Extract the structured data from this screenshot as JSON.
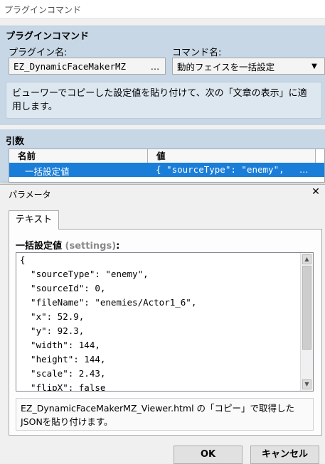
{
  "window": {
    "title": "プラグインコマンド"
  },
  "plugin_command": {
    "section_title": "プラグインコマンド",
    "plugin_label": "プラグイン名:",
    "plugin_value": "EZ_DynamicFaceMakerMZ",
    "plugin_button": "…",
    "command_label": "コマンド名:",
    "command_value": "動的フェイスを一括設定",
    "command_arrow": "▼",
    "description": "ビューワーでコピーした設定値を貼り付けて、次の「文章の表示」に適用します。"
  },
  "arguments": {
    "section_title": "引数",
    "columns": [
      "名前",
      "値"
    ],
    "rows": [
      {
        "name": "一括設定値",
        "value": "{ \"sourceType\": \"enemy\",",
        "more": "…"
      }
    ]
  },
  "dialog": {
    "title": "パラメータ",
    "close_glyph": "✕",
    "tab_label": "テキスト",
    "param_label": "一括設定値",
    "param_key": "(settings)",
    "param_colon": ":",
    "code_lines": [
      "{",
      "  \"sourceType\": \"enemy\",",
      "  \"sourceId\": 0,",
      "  \"fileName\": \"enemies/Actor1_6\",",
      "  \"x\": 52.9,",
      "  \"y\": 92.3,",
      "  \"width\": 144,",
      "  \"height\": 144,",
      "  \"scale\": 2.43,",
      "  \"flipX\": false"
    ],
    "scroll_up_glyph": "▲",
    "scroll_down_glyph": "▼",
    "help_text": "EZ_DynamicFaceMakerMZ_Viewer.html の「コピー」で取得したJSONを貼り付けます。",
    "ok_label": "OK",
    "cancel_label": "キャンセル"
  }
}
